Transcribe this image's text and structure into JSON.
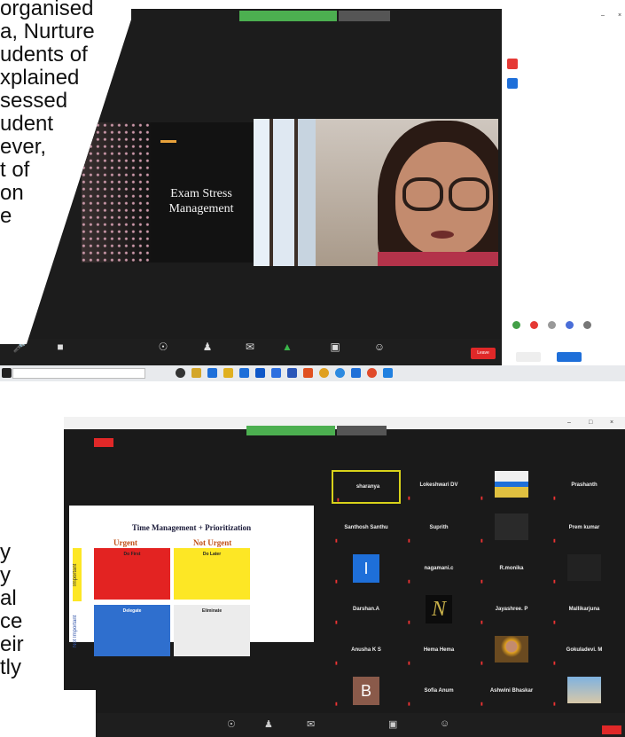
{
  "page_text_top": [
    " organised",
    "a, Nurture",
    "udents of",
    "xplained",
    "sessed",
    "udent",
    "ever,",
    "t of",
    "on",
    "e"
  ],
  "page_text_bottom": [
    "y",
    "y",
    "al",
    "ce",
    "eir",
    "tly"
  ],
  "slide1": {
    "title": "Exam Stress Management"
  },
  "slide2": {
    "title": "Time Management + Prioritization",
    "col_urgent": "Urgent",
    "col_not_urgent": "Not Urgent",
    "row_important": "Important",
    "row_not_important": "Not Important",
    "quadrants": [
      {
        "head": "Do First",
        "color": "#e32322"
      },
      {
        "head": "Do Later",
        "color": "#fde725"
      },
      {
        "head": "Delegate",
        "color": "#2f6fce"
      },
      {
        "head": "Eliminate",
        "color": "#ececec"
      }
    ]
  },
  "toolbar1": {
    "end_label": "Leave"
  },
  "participants_grid": [
    "sharanya",
    "Lokeshwari DV",
    "",
    "Prashanth",
    "Santhosh Santhu",
    "Suprith",
    "",
    "Prem kumar",
    "",
    "nagamani.c",
    "R.monika",
    "",
    "Darshan.A",
    "",
    "Jayashree. P",
    "Mallikarjuna",
    "Anusha K S",
    "Hema Hema",
    "",
    "Gokuladevi. M",
    "",
    "Sofia Anum",
    "Ashwini Bhaskar",
    ""
  ],
  "grid_initials": {
    "tile_9": "I",
    "tile_14": "N",
    "tile_21": "B"
  },
  "colors": {
    "zoom_green": "#4caf50",
    "end_red": "#e02828",
    "dark_bg": "#1c1c1c",
    "select_border": "#d8d21a"
  },
  "icons": [
    "mic-icon",
    "video-icon",
    "security-icon",
    "participants-icon",
    "chat-icon",
    "share-screen-icon",
    "record-icon",
    "reactions-icon",
    "windows-start-icon",
    "search-icon"
  ]
}
